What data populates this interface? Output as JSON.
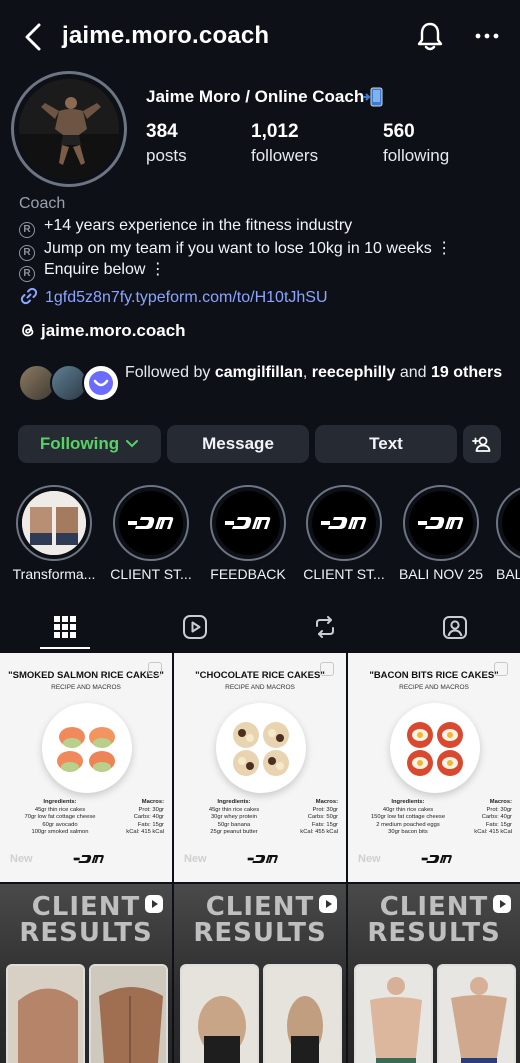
{
  "header": {
    "username": "jaime.moro.coach"
  },
  "profile": {
    "display_name": "Jaime Moro / Online Coach",
    "stats": [
      {
        "value": "384",
        "label": "posts"
      },
      {
        "value": "1,012",
        "label": "followers"
      },
      {
        "value": "560",
        "label": "following"
      }
    ],
    "category": "Coach",
    "bio": [
      "+14 years experience in the fitness industry",
      "Jump on my team if you want to lose 10kg in 10 weeks ⋮",
      "Enquire below ⋮"
    ],
    "link": "1gfd5z8n7fy.typeform.com/to/H10tJhSU",
    "threads_handle": "jaime.moro.coach",
    "followed_by": {
      "prefix": "Followed by",
      "names": [
        "camgilfillan",
        "reecephilly"
      ],
      "and": "and",
      "others": "19 others"
    }
  },
  "actions": {
    "following": "Following",
    "message": "Message",
    "text": "Text"
  },
  "highlights": [
    {
      "label": "Transforma..."
    },
    {
      "label": "CLIENT ST..."
    },
    {
      "label": "FEEDBACK"
    },
    {
      "label": "CLIENT ST..."
    },
    {
      "label": "BALI NOV 25"
    },
    {
      "label": "BAL"
    }
  ],
  "posts": {
    "recipes": [
      {
        "title": "\"SMOKED SALMON RICE CAKES\"",
        "subtitle": "RECIPE AND MACROS",
        "ingredients_head": "Ingredients:",
        "ingredients": [
          "45gr thin rice cakes",
          "70gr low fat cottage cheese",
          "60gr avocado",
          "100gr smoked salmon"
        ],
        "macros_head": "Macros:",
        "macros": [
          "Prot: 30gr",
          "Carbs: 40gr",
          "Fats: 15gr",
          "kCal: 415 kCal"
        ],
        "tag": "New"
      },
      {
        "title": "\"CHOCOLATE RICE CAKES\"",
        "subtitle": "RECIPE AND MACROS",
        "ingredients_head": "Ingredients:",
        "ingredients": [
          "45gr thin rice cakes",
          "30gr whey protein",
          "50gr banana",
          "25gr peanut butter"
        ],
        "macros_head": "Macros:",
        "macros": [
          "Prot: 30gr",
          "Carbs: 50gr",
          "Fats: 15gr",
          "kCal: 455 kCal"
        ],
        "tag": "New"
      },
      {
        "title": "\"BACON BITS RICE CAKES\"",
        "subtitle": "RECIPE AND MACROS",
        "ingredients_head": "Ingredients:",
        "ingredients": [
          "40gr thin rice cakes",
          "150gr low fat cottage cheese",
          "2 medium poached eggs",
          "30gr bacon bits"
        ],
        "macros_head": "Macros:",
        "macros": [
          "Prot: 30gr",
          "Carbs: 40gr",
          "Fats: 15gr",
          "kCal: 415 kCal"
        ],
        "tag": "New"
      }
    ],
    "results": [
      {
        "overlay": "CLIENT RESULTS"
      },
      {
        "overlay": "CLIENT RESULTS"
      },
      {
        "overlay": "CLIENT RESULTS"
      }
    ]
  },
  "icons": {
    "back": "chevron-left-icon",
    "bell": "bell-icon",
    "more": "more-horizontal-icon",
    "phone": "mobile-phone-icon",
    "link": "link-icon",
    "threads": "threads-icon",
    "add_person": "add-person-icon",
    "grid": "grid-icon",
    "reels": "reels-icon",
    "reposts": "repost-icon",
    "tagged": "tagged-icon"
  },
  "colors": {
    "background": "#0d1117",
    "button": "#262b33",
    "following_green": "#56d364",
    "link_blue": "#8ba4ff"
  }
}
